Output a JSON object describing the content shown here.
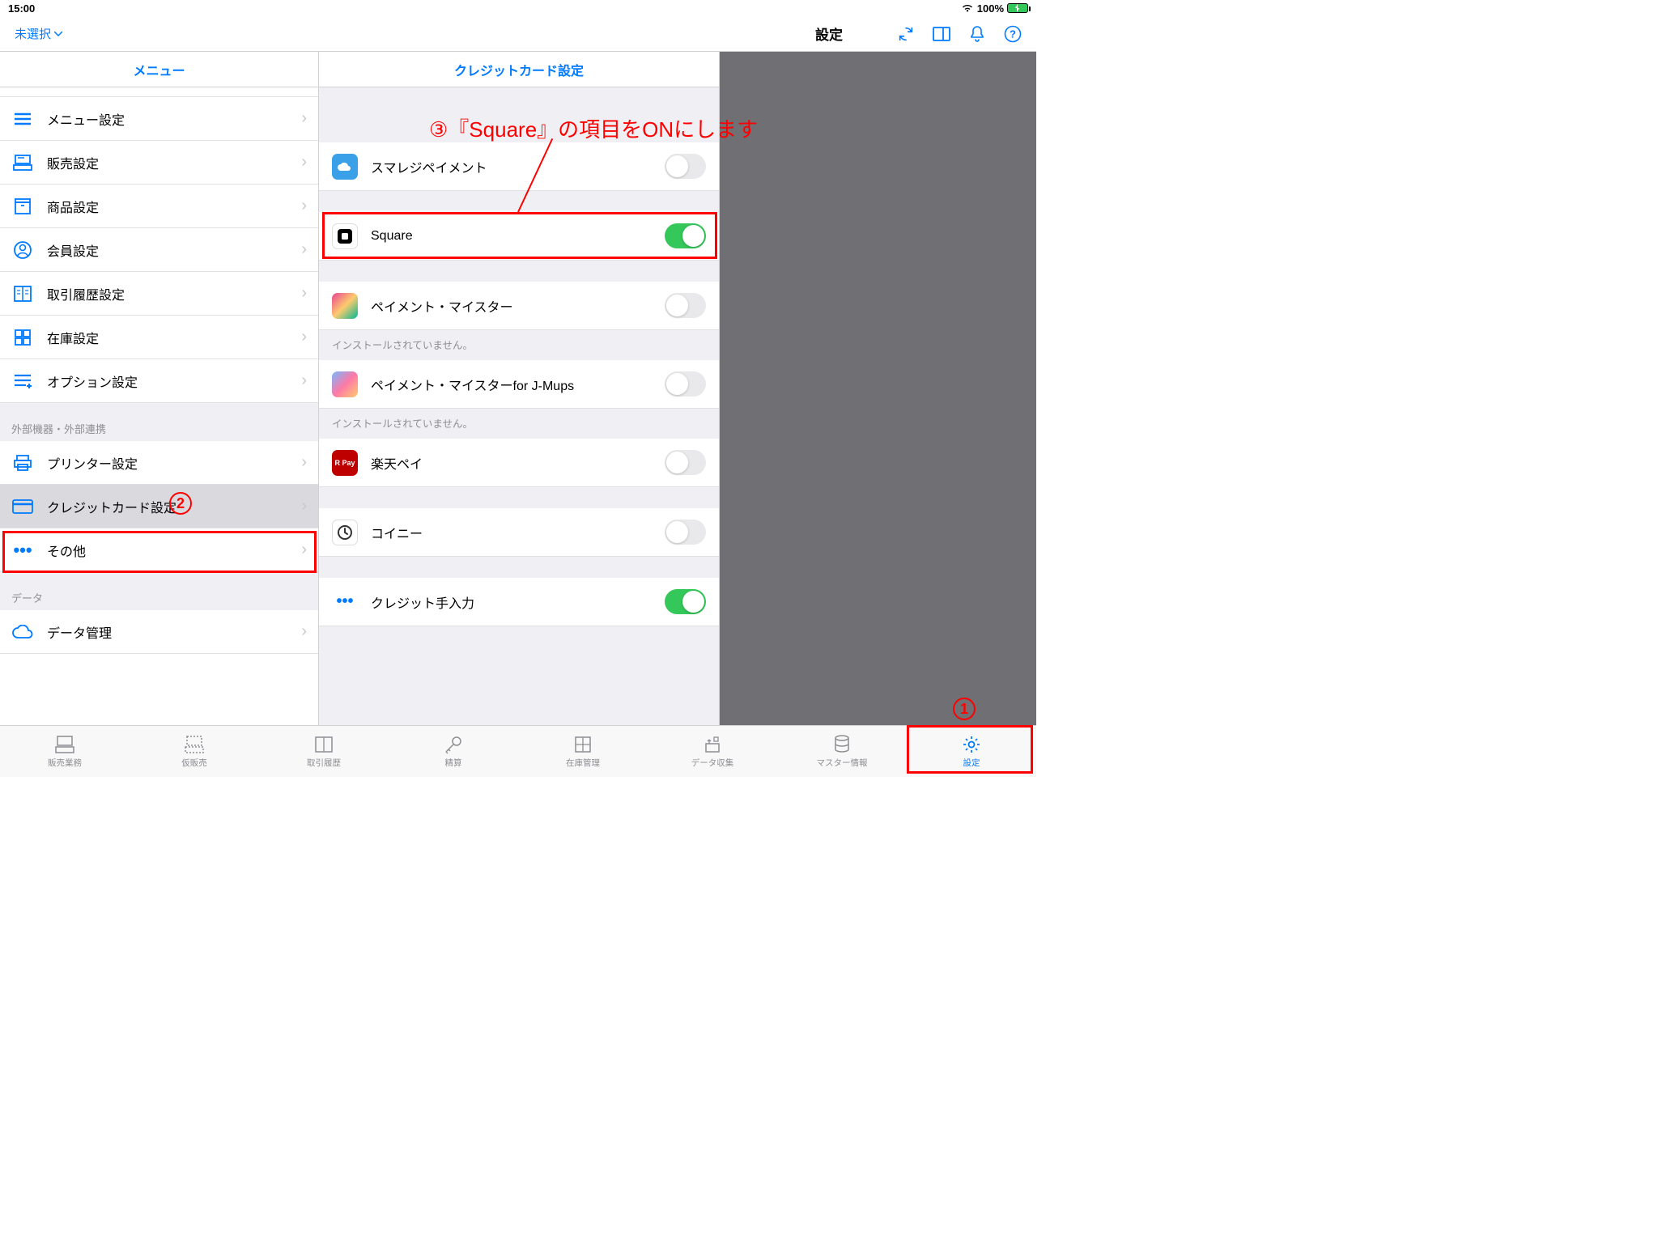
{
  "status": {
    "time": "15:00",
    "battery_pct": "100%"
  },
  "nav": {
    "left": "未選択",
    "title": "設定"
  },
  "left_panel": {
    "header": "メニュー",
    "items_top": [
      {
        "label": "メニュー設定"
      },
      {
        "label": "販売設定"
      },
      {
        "label": "商品設定"
      },
      {
        "label": "会員設定"
      },
      {
        "label": "取引履歴設定"
      },
      {
        "label": "在庫設定"
      },
      {
        "label": "オプション設定"
      }
    ],
    "section_devices": "外部機器・外部連携",
    "items_devices": [
      {
        "label": "プリンター設定"
      },
      {
        "label": "クレジットカード設定",
        "selected": true
      },
      {
        "label": "その他"
      }
    ],
    "section_data": "データ",
    "items_data": [
      {
        "label": "データ管理"
      }
    ]
  },
  "mid_panel": {
    "header": "クレジットカード設定",
    "rows": [
      {
        "label": "スマレジペイメント",
        "icon_bg": "#3aa0e8",
        "on": false
      },
      {
        "label": "Square",
        "icon_bg": "#ffffff",
        "on": true,
        "square_icon": true
      },
      {
        "label": "ペイメント・マイスター",
        "icon_bg": "#9b4fa8",
        "on": false,
        "note": "インストールされていません。"
      },
      {
        "label": "ペイメント・マイスターfor J-Mups",
        "icon_bg": "#fc8a3a",
        "on": false,
        "note": "インストールされていません。"
      },
      {
        "label": "楽天ペイ",
        "icon_bg": "#bf0000",
        "icon_text": "R Pay",
        "on": false
      },
      {
        "label": "コイニー",
        "icon_bg": "#ffffff",
        "coiney_icon": true,
        "on": false
      },
      {
        "label": "クレジット手入力",
        "dots_icon": true,
        "on": true
      }
    ]
  },
  "callouts": {
    "step3_text": "③『Square』の項目をONにします"
  },
  "tabs": [
    {
      "label": "販売業務"
    },
    {
      "label": "仮販売"
    },
    {
      "label": "取引履歴"
    },
    {
      "label": "精算"
    },
    {
      "label": "在庫管理"
    },
    {
      "label": "データ収集"
    },
    {
      "label": "マスター情報"
    },
    {
      "label": "設定",
      "active": true
    }
  ]
}
